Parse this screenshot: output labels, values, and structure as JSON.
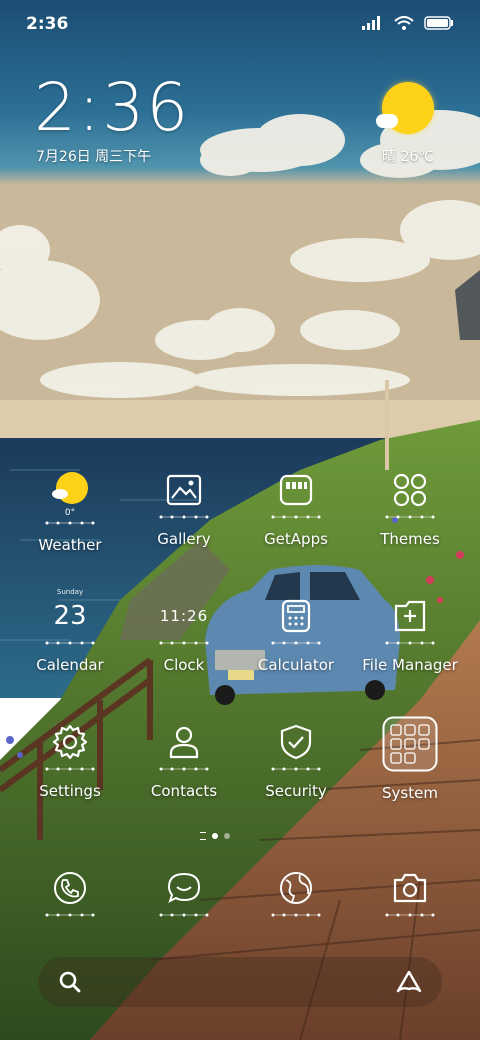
{
  "status_bar": {
    "time": "2:36"
  },
  "clock_widget": {
    "time": "2:36",
    "date": "7月26日 周三下午"
  },
  "weather_widget": {
    "temp": "晴 26℃"
  },
  "apps": [
    {
      "label": "Weather",
      "icon": "weather-icon",
      "badge": "0°"
    },
    {
      "label": "Gallery",
      "icon": "gallery-icon"
    },
    {
      "label": "GetApps",
      "icon": "getapps-icon"
    },
    {
      "label": "Themes",
      "icon": "themes-icon"
    },
    {
      "label": "Calendar",
      "icon": "calendar-icon",
      "day_name": "Sunday",
      "day_num": "23"
    },
    {
      "label": "Clock",
      "icon": "clock-icon",
      "time_text": "11:26"
    },
    {
      "label": "Calculator",
      "icon": "calculator-icon"
    },
    {
      "label": "File Manager",
      "icon": "file-manager-icon"
    },
    {
      "label": "Settings",
      "icon": "settings-gear-icon"
    },
    {
      "label": "Contacts",
      "icon": "contacts-icon"
    },
    {
      "label": "Security",
      "icon": "security-shield-icon"
    },
    {
      "label": "System",
      "icon": "system-folder-icon"
    }
  ],
  "dock": [
    {
      "icon": "phone-icon"
    },
    {
      "icon": "messages-icon"
    },
    {
      "icon": "browser-icon"
    },
    {
      "icon": "camera-icon"
    }
  ],
  "pager": {
    "pages": 2,
    "current": 1
  },
  "search_bar": {
    "left_icon": "search-icon",
    "right_icon": "assistant-icon"
  },
  "colors": {
    "sun": "#ffd21a",
    "sky": "#2c6f95",
    "sea": "#1b3b5c",
    "path": "#a8704a"
  }
}
